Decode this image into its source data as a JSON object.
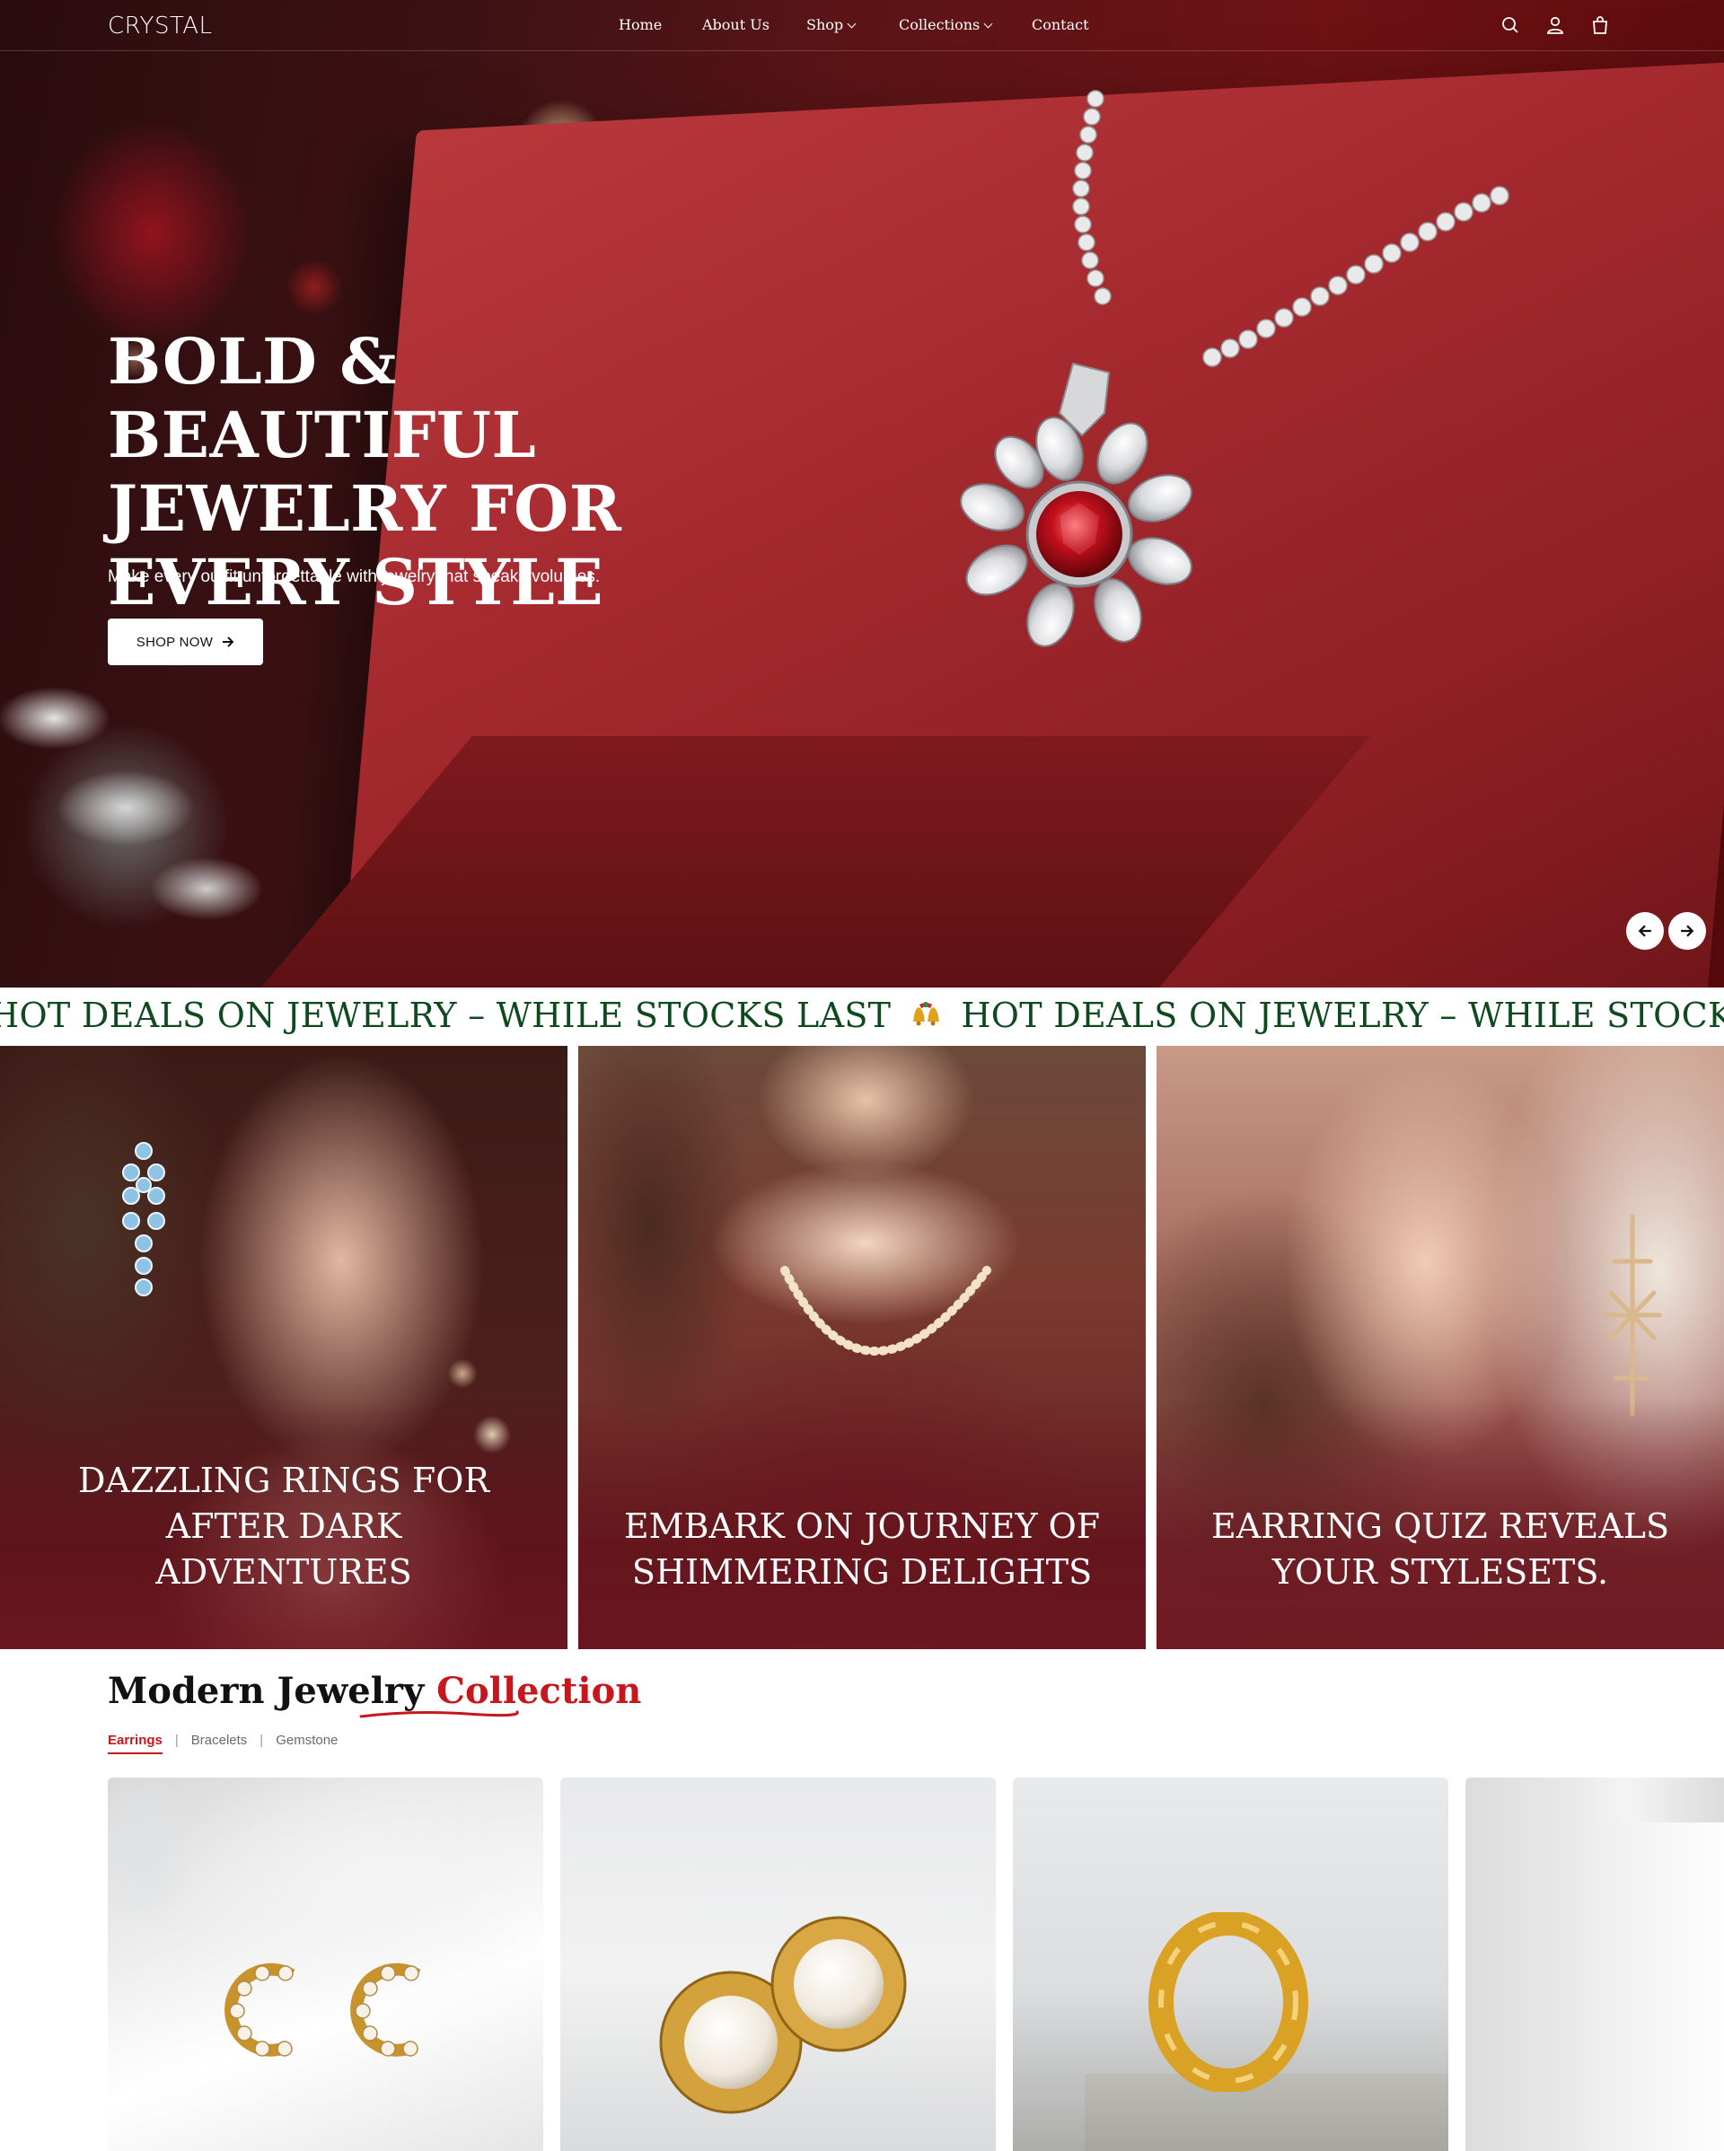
{
  "header": {
    "logo": "CRYSTAL",
    "nav": [
      {
        "label": "Home",
        "dropdown": false
      },
      {
        "label": "About Us",
        "dropdown": false
      },
      {
        "label": "Shop",
        "dropdown": true
      },
      {
        "label": "Collections",
        "dropdown": true
      },
      {
        "label": "Contact",
        "dropdown": false
      }
    ],
    "icons": [
      "search-icon",
      "user-icon",
      "cart-icon"
    ]
  },
  "hero": {
    "title": "BOLD & BEAUTIFUL JEWELRY FOR EVERY STYLE",
    "subtitle": "Make every outfit unforgettable with jewelry that speaks volumes.",
    "button_label": "SHOP NOW",
    "slider_controls": [
      "arrow-left-icon",
      "arrow-right-icon"
    ]
  },
  "marquee": {
    "text": "HOT DEALS ON JEWELRY – WHILE STOCKS LAST",
    "separator_icon": "bells-icon",
    "text_color": "#0f4a1f"
  },
  "promos": [
    {
      "text": "DAZZLING RINGS FOR AFTER DARK ADVENTURES"
    },
    {
      "text": "EMBARK ON JOURNEY OF SHIMMERING DELIGHTS"
    },
    {
      "text": "EARRING QUIZ REVEALS YOUR STYLESETS."
    }
  ],
  "collection": {
    "title_part1": "Modern Jewelry ",
    "title_part2": "Collection",
    "accent_color": "#c8161d",
    "tabs": [
      {
        "label": "Earrings",
        "active": true
      },
      {
        "label": "Bracelets",
        "active": false
      },
      {
        "label": "Gemstone",
        "active": false
      }
    ],
    "products": [
      "pearl-hoop-earrings-image",
      "pearl-cluster-earrings-image",
      "gold-ring-image",
      "necklace-display-image"
    ]
  }
}
